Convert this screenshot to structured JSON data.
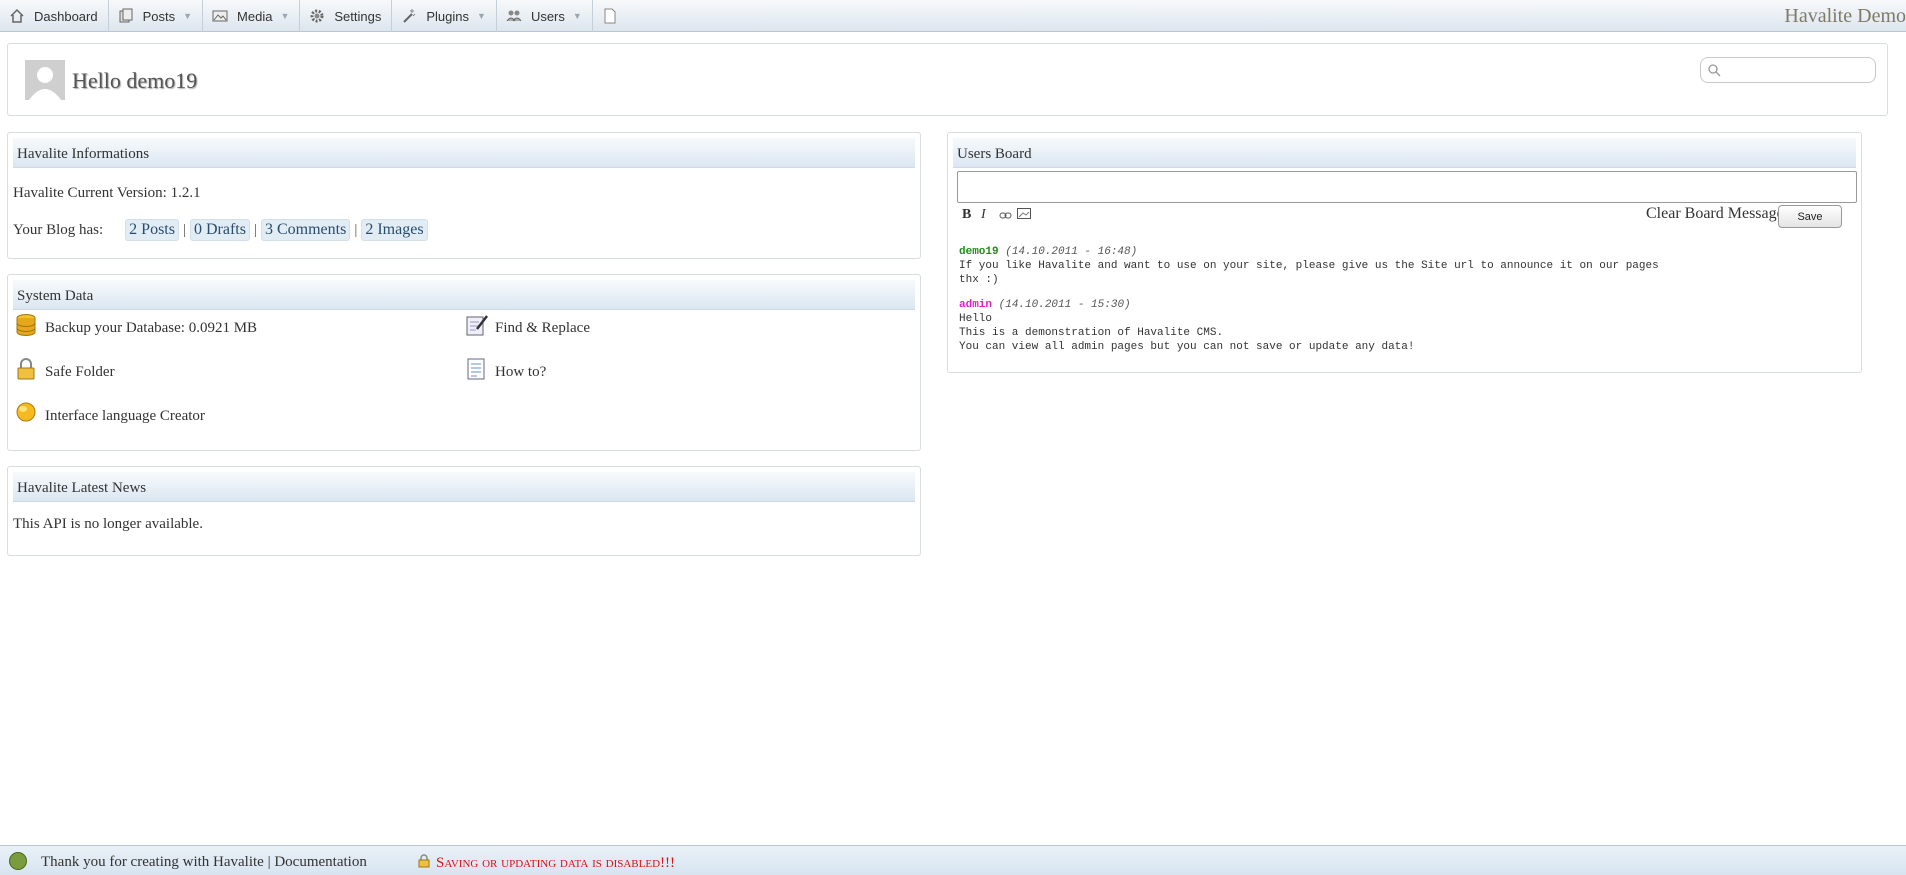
{
  "nav": {
    "items": [
      {
        "label": "Dashboard",
        "icon": "home-icon",
        "has_menu": false
      },
      {
        "label": "Posts",
        "icon": "posts-icon",
        "has_menu": true
      },
      {
        "label": "Media",
        "icon": "media-icon",
        "has_menu": true
      },
      {
        "label": "Settings",
        "icon": "gear-icon",
        "has_menu": false
      },
      {
        "label": "Plugins",
        "icon": "wand-icon",
        "has_menu": true
      },
      {
        "label": "Users",
        "icon": "users-icon",
        "has_menu": true
      }
    ],
    "brand": "Havalite Demo"
  },
  "header": {
    "greeting": "Hello demo19",
    "search_placeholder": ""
  },
  "info_panel": {
    "title": "Havalite Informations",
    "version_label": "Havalite Current Version: 1.2.1",
    "blog_has_label": "Your Blog has:",
    "stats": [
      "2 Posts",
      "0 Drafts",
      "3 Comments",
      "2 Images"
    ],
    "separator": "|"
  },
  "system_panel": {
    "title": "System Data",
    "items": {
      "backup": "Backup your Database: 0.0921 MB",
      "find_replace": "Find & Replace",
      "safe_folder": "Safe Folder",
      "how_to": "How to?",
      "lang_creator": "Interface language Creator"
    }
  },
  "news_panel": {
    "title": "Havalite Latest News",
    "body": "This API is no longer available."
  },
  "board": {
    "title": "Users Board",
    "format_buttons": {
      "bold": "B",
      "italic": "I"
    },
    "clear_label": "Clear Board Messages",
    "save_label": "Save",
    "messages": [
      {
        "user": "demo19",
        "timestamp": "(14.10.2011 - 16:48)",
        "lines": [
          "If you like Havalite and want to use on your site, please give us the Site url to announce it on our pages",
          "thx :)"
        ]
      },
      {
        "user": "admin",
        "timestamp": "(14.10.2011 - 15:30)",
        "lines": [
          "Hello",
          "This is a demonstration of Havalite CMS.",
          "You can view all admin pages but you can not save or update any data!"
        ]
      }
    ]
  },
  "footer": {
    "text": "Thank you for creating with Havalite | Documentation",
    "warning": "Saving or updating data is disabled!!!"
  },
  "colors": {
    "user_demo19": "#228b22",
    "user_admin": "#e11ec8",
    "warning": "#dd1111",
    "link": "#2a4d6e"
  }
}
